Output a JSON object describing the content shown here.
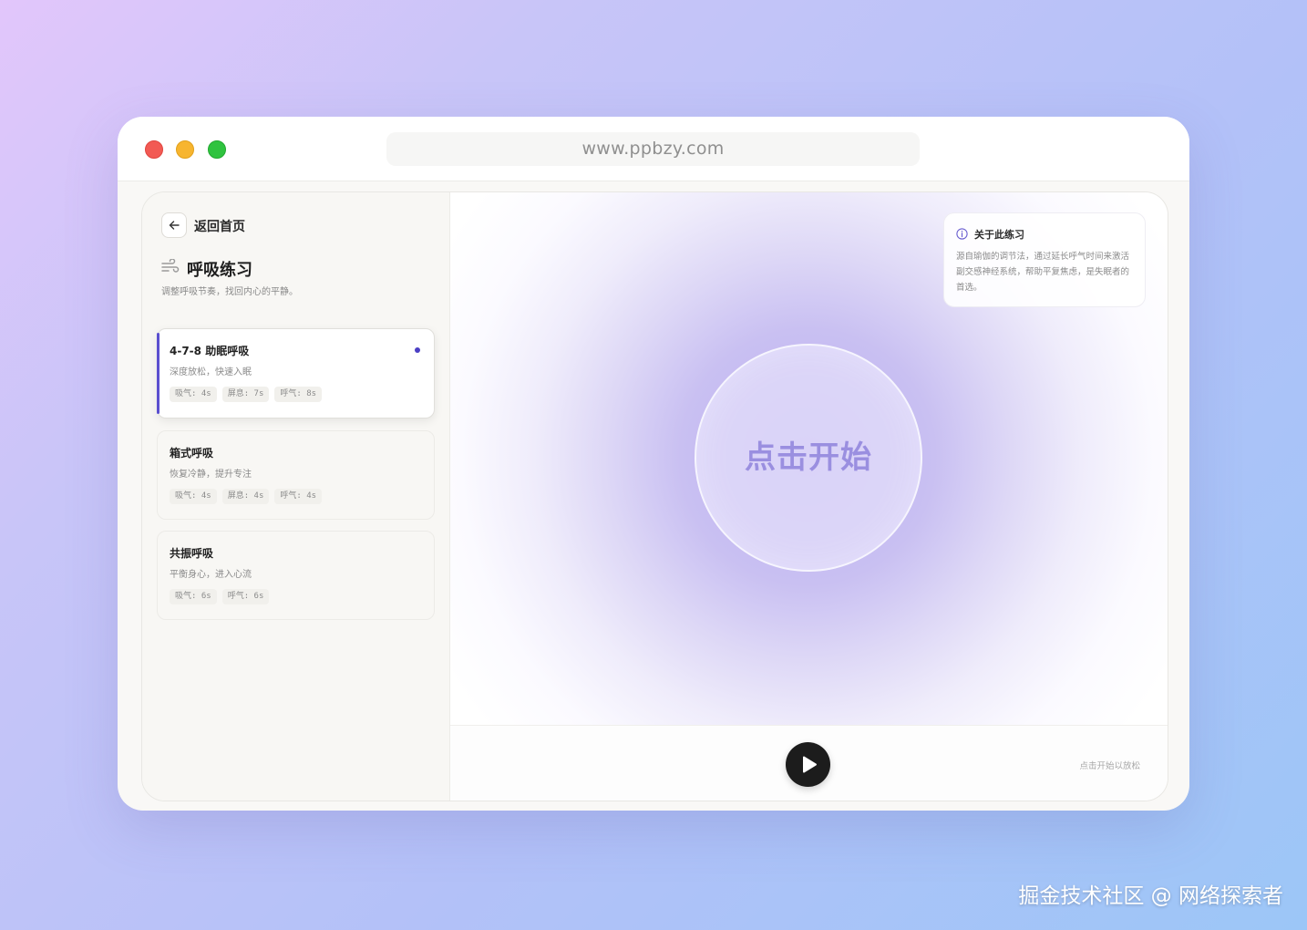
{
  "browser": {
    "url": "www.ppbzy.com"
  },
  "sidebar": {
    "back_label": "返回首页",
    "title": "呼吸练习",
    "subtitle": "调整呼吸节奏，找回内心的平静。",
    "cards": [
      {
        "title": "4-7-8 助眠呼吸",
        "desc": "深度放松，快速入眠",
        "tags": [
          "吸气: 4s",
          "屏息: 7s",
          "呼气: 8s"
        ],
        "active": true
      },
      {
        "title": "箱式呼吸",
        "desc": "恢复冷静，提升专注",
        "tags": [
          "吸气: 4s",
          "屏息: 4s",
          "呼气: 4s"
        ],
        "active": false
      },
      {
        "title": "共振呼吸",
        "desc": "平衡身心，进入心流",
        "tags": [
          "吸气: 6s",
          "呼气: 6s"
        ],
        "active": false
      }
    ]
  },
  "info": {
    "title": "关于此练习",
    "body": "源自瑜伽的调节法，通过延长呼气时间来激活副交感神经系统，帮助平复焦虑，是失眠者的首选。"
  },
  "stage": {
    "center_label": "点击开始"
  },
  "footer": {
    "hint": "点击开始以放松"
  },
  "watermark": "掘金技术社区 @ 网络探索者",
  "colors": {
    "accent": "#5a4fcf",
    "circle_text": "#9a8fe0",
    "play_button": "#1c1c1c"
  }
}
